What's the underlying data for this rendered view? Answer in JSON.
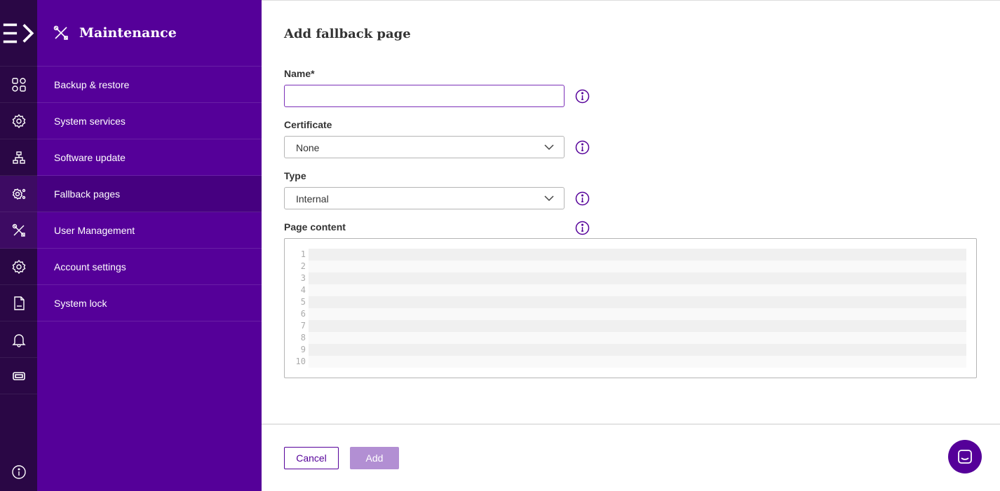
{
  "sidebar": {
    "title": "Maintenance",
    "items": [
      {
        "label": "Backup & restore"
      },
      {
        "label": "System services"
      },
      {
        "label": "Software update"
      },
      {
        "label": "Fallback pages",
        "active": true
      },
      {
        "label": "User Management"
      },
      {
        "label": "Account settings"
      },
      {
        "label": "System lock"
      }
    ]
  },
  "rail": {
    "icons": [
      "expand-menu-icon",
      "dashboard-icon",
      "gear-shield-icon",
      "network-icon",
      "gear-settings-icon",
      "tools-icon",
      "settings-icon",
      "log-file-icon",
      "bell-icon",
      "ticket-icon",
      "info-icon"
    ]
  },
  "form": {
    "title": "Add fallback page",
    "name_label": "Name*",
    "name_value": "",
    "certificate_label": "Certificate",
    "certificate_value": "None",
    "type_label": "Type",
    "type_value": "Internal",
    "content_label": "Page content",
    "line_numbers": [
      "1",
      "2",
      "3",
      "4",
      "5",
      "6",
      "7",
      "8",
      "9",
      "10"
    ]
  },
  "actions": {
    "cancel_label": "Cancel",
    "add_label": "Add"
  },
  "colors": {
    "sidebar": "#550099",
    "rail": "#2a0745",
    "accent": "#550099",
    "add_disabled": "#b28fd3"
  }
}
